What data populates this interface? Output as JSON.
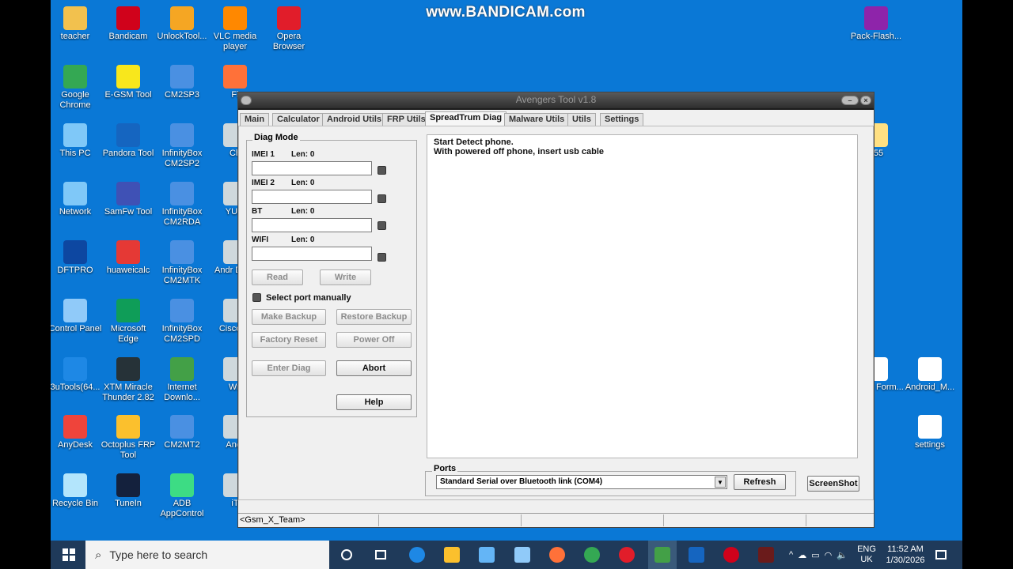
{
  "watermark": "www.BANDICAM.com",
  "desktop_icons": [
    {
      "label": "teacher",
      "color": "#f2c14e"
    },
    {
      "label": "Bandicam",
      "color": "#d0021b"
    },
    {
      "label": "UnlockTool...",
      "color": "#f5a623"
    },
    {
      "label": "VLC media player",
      "color": "#ff8800"
    },
    {
      "label": "Opera Browser",
      "color": "#e11d2a"
    },
    {
      "label": "Google Chrome",
      "color": "#34a853"
    },
    {
      "label": "E-GSM Tool",
      "color": "#f8e71c"
    },
    {
      "label": "CM2SP3",
      "color": "#4a90e2"
    },
    {
      "label": "Fi",
      "color": "#ff7139"
    },
    {
      "label": "This PC",
      "color": "#7fc8f8"
    },
    {
      "label": "Pandora Tool",
      "color": "#1565c0"
    },
    {
      "label": "InfinityBox CM2SP2",
      "color": "#4a90e2"
    },
    {
      "label": "Ch",
      "color": "#cfd8dc"
    },
    {
      "label": "Network",
      "color": "#7fc8f8"
    },
    {
      "label": "SamFw Tool",
      "color": "#3f51b5"
    },
    {
      "label": "InfinityBox CM2RDA",
      "color": "#4a90e2"
    },
    {
      "label": "YUM",
      "color": "#cfd8dc"
    },
    {
      "label": "DFTPRO",
      "color": "#0d47a1"
    },
    {
      "label": "huaweicalc",
      "color": "#e53935"
    },
    {
      "label": "InfinityBox CM2MTK",
      "color": "#4a90e2"
    },
    {
      "label": "Andr Drive",
      "color": "#cfd8dc"
    },
    {
      "label": "Control Panel",
      "color": "#90caf9"
    },
    {
      "label": "Microsoft Edge",
      "color": "#0f9d58"
    },
    {
      "label": "InfinityBox CM2SPD",
      "color": "#4a90e2"
    },
    {
      "label": "Cisco Tr",
      "color": "#cfd8dc"
    },
    {
      "label": "3uTools(64...",
      "color": "#1e88e5"
    },
    {
      "label": "XTM Miracle Thunder 2.82",
      "color": "#263238"
    },
    {
      "label": "Internet Downlo...",
      "color": "#43a047"
    },
    {
      "label": "Wri",
      "color": "#cfd8dc"
    },
    {
      "label": "AnyDesk",
      "color": "#ef443b"
    },
    {
      "label": "Octoplus FRP Tool",
      "color": "#fbc02d"
    },
    {
      "label": "CM2MT2",
      "color": "#4a90e2"
    },
    {
      "label": "Andr",
      "color": "#cfd8dc"
    },
    {
      "label": "Recycle Bin",
      "color": "#b3e5fc"
    },
    {
      "label": "TuneIn",
      "color": "#14213d"
    },
    {
      "label": "ADB AppControl",
      "color": "#3ddc84"
    },
    {
      "label": "iT",
      "color": "#cfd8dc"
    },
    {
      "label": "Pack-Flash...",
      "color": "#8e24aa"
    },
    {
      "label": "555",
      "color": "#ffe082"
    },
    {
      "label": "ed kits Form...",
      "color": "#ffffff"
    },
    {
      "label": "Android_M...",
      "color": "#ffffff"
    },
    {
      "label": "settings",
      "color": "#ffffff"
    }
  ],
  "window": {
    "title": "Avengers Tool v1.8",
    "tabs": [
      "Main",
      "Calculator",
      "Android Utils",
      "FRP Utils",
      "SpreadTrum Diag",
      "Malware Utils",
      "Utils",
      "Settings"
    ],
    "active_tab": "SpreadTrum Diag",
    "diag_mode_title": "Diag Mode",
    "fields": [
      {
        "label": "IMEI 1",
        "len": "Len: 0",
        "value": ""
      },
      {
        "label": "IMEI 2",
        "len": "Len: 0",
        "value": ""
      },
      {
        "label": "BT",
        "len": "Len: 0",
        "value": ""
      },
      {
        "label": "WIFI",
        "len": "Len: 0",
        "value": ""
      }
    ],
    "read_label": "Read",
    "write_label": "Write",
    "select_port_label": "Select port manually",
    "make_backup_label": "Make Backup",
    "restore_backup_label": "Restore Backup",
    "factory_reset_label": "Factory Reset",
    "power_off_label": "Power Off",
    "enter_diag_label": "Enter Diag",
    "abort_label": "Abort",
    "help_label": "Help",
    "log_lines": [
      "Start Detect phone.",
      "With powered off phone, insert usb cable"
    ],
    "ports_title": "Ports",
    "port_selected": "Standard Serial over Bluetooth link (COM4)",
    "refresh_label": "Refresh",
    "screenshot_label": "ScreenShot",
    "status_text": "<Gsm_X_Team>"
  },
  "taskbar": {
    "search_placeholder": "Type here to search",
    "lang_line1": "ENG",
    "lang_line2": "UK",
    "time": "11:52 AM",
    "date": "1/30/2026"
  }
}
